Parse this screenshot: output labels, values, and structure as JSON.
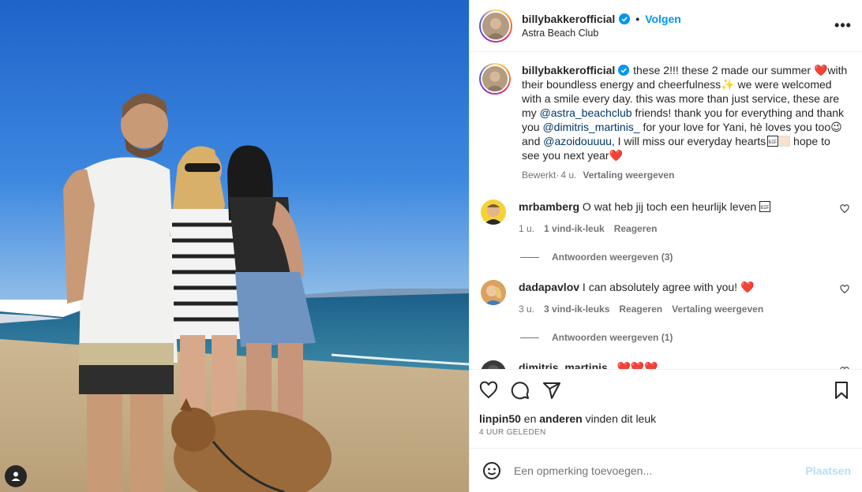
{
  "post": {
    "username": "billybakkerofficial",
    "follow_label": "Volgen",
    "location": "Astra Beach Club",
    "more_label": "•••",
    "caption": {
      "username": "billybakkerofficial",
      "t1": " these 2!!! these 2 made our summer ",
      "heart1": "❤️",
      "t2": "with their boundless energy and cheerfulness",
      "sparkles": "✨",
      "t3": " we were welcomed with a smile every day. this was more than just service, these are my ",
      "mention1": "@astra_beachclub",
      "t4": " friends! thank you for everything and thank you ",
      "mention2": "@dimitris_martinis_",
      "t5": " for your love for Yani, hè loves you too",
      "wink": "😉",
      "t6": "and ",
      "mention3": "@azoidouuuu",
      "t7": ", I will miss our everyday hearts",
      "t8": " hope to see you next year",
      "heart2": "❤️",
      "edited": "Bewerkt",
      "age": "4 u.",
      "translate": "Vertaling weergeven"
    }
  },
  "comments": [
    {
      "username": "mrbamberg",
      "text": " O wat heb jij toch een heurlijk leven ",
      "age": "1 u.",
      "likes": "1 vind-ik-leuk",
      "reply": "Reageren",
      "replies": "Antwoorden weergeven (3)"
    },
    {
      "username": "dadapavlov",
      "text": " I can absolutely agree with you! ",
      "emoji": "❤️",
      "age": "3 u.",
      "likes": "3 vind-ik-leuks",
      "reply": "Reageren",
      "translate": "Vertaling weergeven",
      "replies": "Antwoorden weergeven (1)"
    },
    {
      "username": "dimitris_martinis_",
      "emoji": " ❤️❤️❤️"
    }
  ],
  "footer": {
    "liked_user": "linpin50",
    "liked_mid": " en ",
    "liked_others": "anderen",
    "liked_end": " vinden dit leuk",
    "time_ago": "4 UUR GELEDEN",
    "comment_placeholder": "Een opmerking toevoegen...",
    "post_label": "Plaatsen"
  },
  "colors": {
    "accent": "#0095f6",
    "like_red": "#ed4956",
    "mention": "#00376b"
  }
}
